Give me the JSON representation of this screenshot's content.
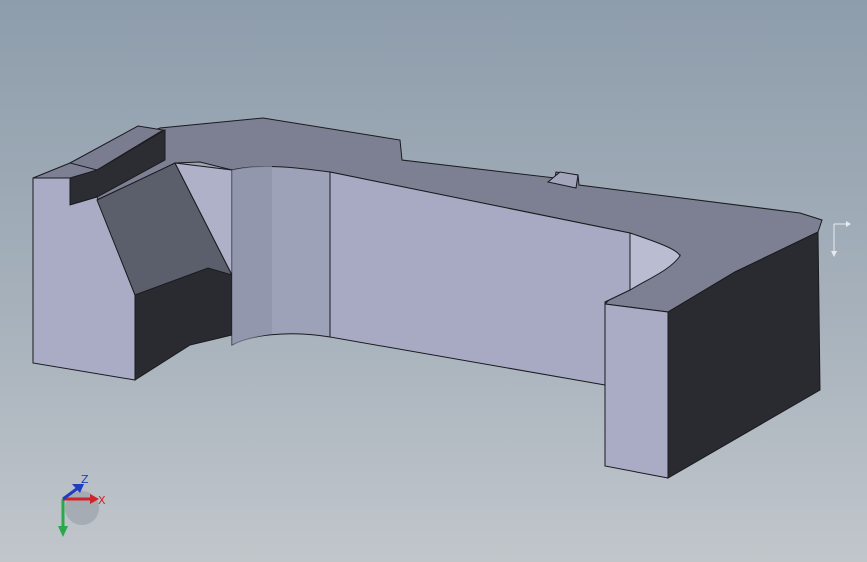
{
  "viewport": {
    "background_top": "#8e9dac",
    "background_bottom": "#c1c6cb"
  },
  "model": {
    "face_top_color": "#7d8092",
    "face_front_color": "#a9acc4",
    "face_side_color": "#2a2b30",
    "face_slope_color": "#5b5f6b",
    "edge_color": "#1a1a1f"
  },
  "triad": {
    "x_label": "X",
    "y_label": "",
    "z_label": "Z",
    "x_color": "#d0232a",
    "y_color": "#2ba84a",
    "z_color": "#1f3fbf"
  },
  "edge_indicator": {
    "icon": "corner-arrow-icon"
  }
}
